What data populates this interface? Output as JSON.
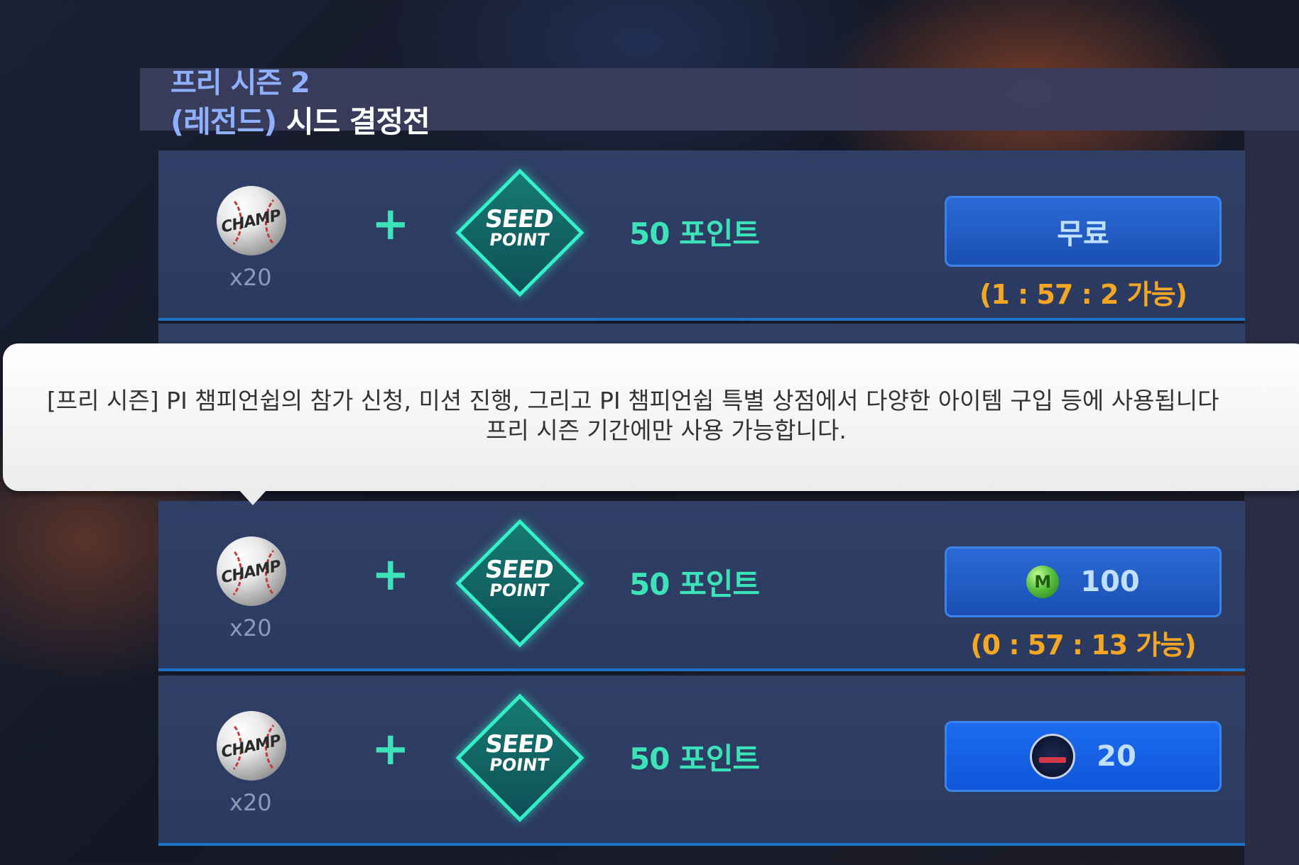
{
  "header": {
    "title_line1": "프리 시즌 2",
    "title_paren": "(레전드)",
    "title_main": "시드 결정전"
  },
  "rows": [
    {
      "reward_qty": "x20",
      "ball_label": "CHAMP",
      "seed_label_1": "SEED",
      "seed_label_2": "POINT",
      "points": "50 포인트",
      "button_label": "무료",
      "cost_icon": null,
      "timer": "(1 : 57 : 2 가능)"
    },
    {
      "reward_qty": "x20",
      "ball_label": "CHAMP",
      "seed_label_1": "SEED",
      "seed_label_2": "POINT",
      "points": "50 포인트",
      "button_label": "100",
      "cost_icon": "m-coin-icon",
      "coin_letter": "M",
      "timer": "(0 : 57 : 13 가능)"
    },
    {
      "reward_qty": "x20",
      "ball_label": "CHAMP",
      "seed_label_1": "SEED",
      "seed_label_2": "POINT",
      "points": "50 포인트",
      "button_label": "20",
      "cost_icon": "ticket-icon",
      "timer": ""
    }
  ],
  "tooltip": {
    "line1": "[프리 시즌] PI 챔피언쉽의 참가 신청,  미션 진행,  그리고 PI 챔피언쉽 특별 상점에서 다양한 아이템 구입 등에 사용됩니다",
    "line2": "프리 시즌 기간에만 사용 가능합니다."
  },
  "colors": {
    "accent_mint": "#3de3b8",
    "timer_orange": "#f5a623",
    "title_blue": "#8fb0ff",
    "button_blue": "#1a4fb3"
  }
}
